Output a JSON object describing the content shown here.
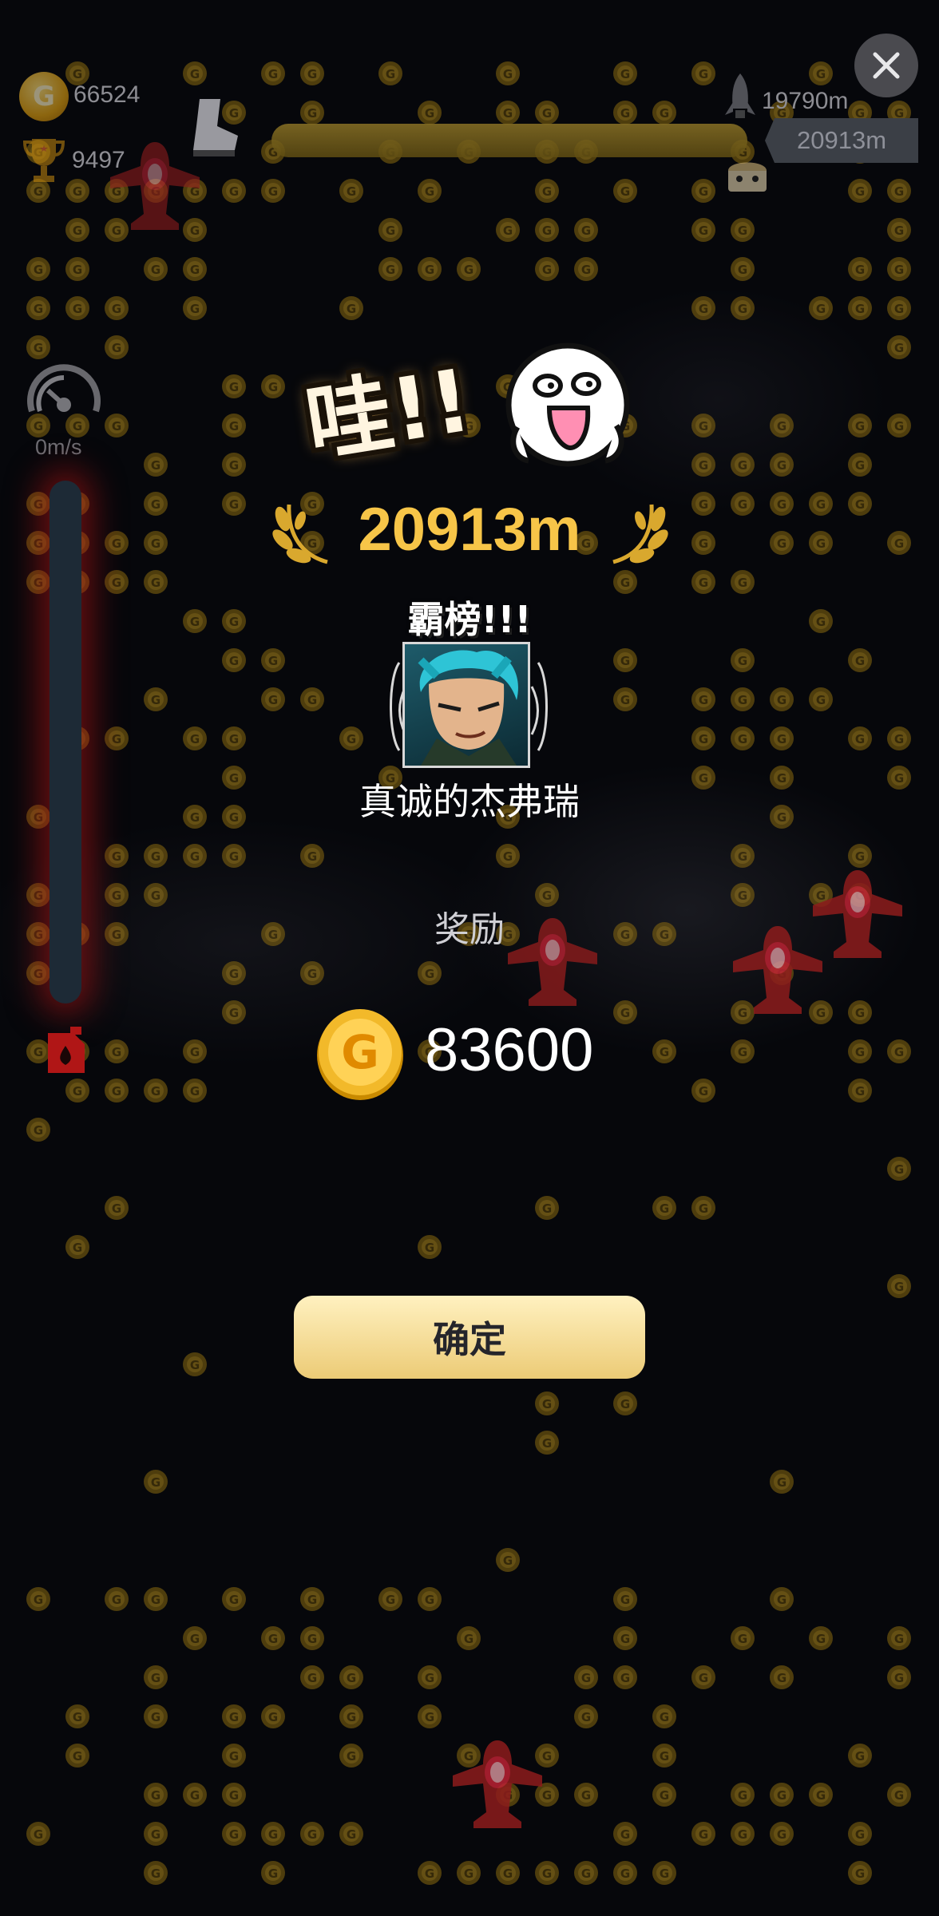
{
  "hud": {
    "coin_count": "66524",
    "trophy_count": "9497",
    "best_record": "19790m",
    "current_distance": "20913m",
    "speed": "0m/s"
  },
  "result": {
    "exclamation": "哇!!",
    "distance": "20913m",
    "rank_label": "霸榜!!!",
    "player_name": "真诚的杰弗瑞",
    "reward_label": "奖励",
    "reward_amount": "83600",
    "confirm_label": "确定"
  },
  "icons": {
    "coin": "coin-icon",
    "close": "close-icon",
    "trophy": "trophy-icon",
    "fuel": "fuel-icon",
    "speed": "speedometer-icon"
  },
  "colors": {
    "accent_gold": "#f7c548",
    "button_gradient_top": "#fff1c0",
    "button_gradient_bottom": "#eccb76",
    "background": "#06070b",
    "fuel_glow": "#b41414"
  }
}
